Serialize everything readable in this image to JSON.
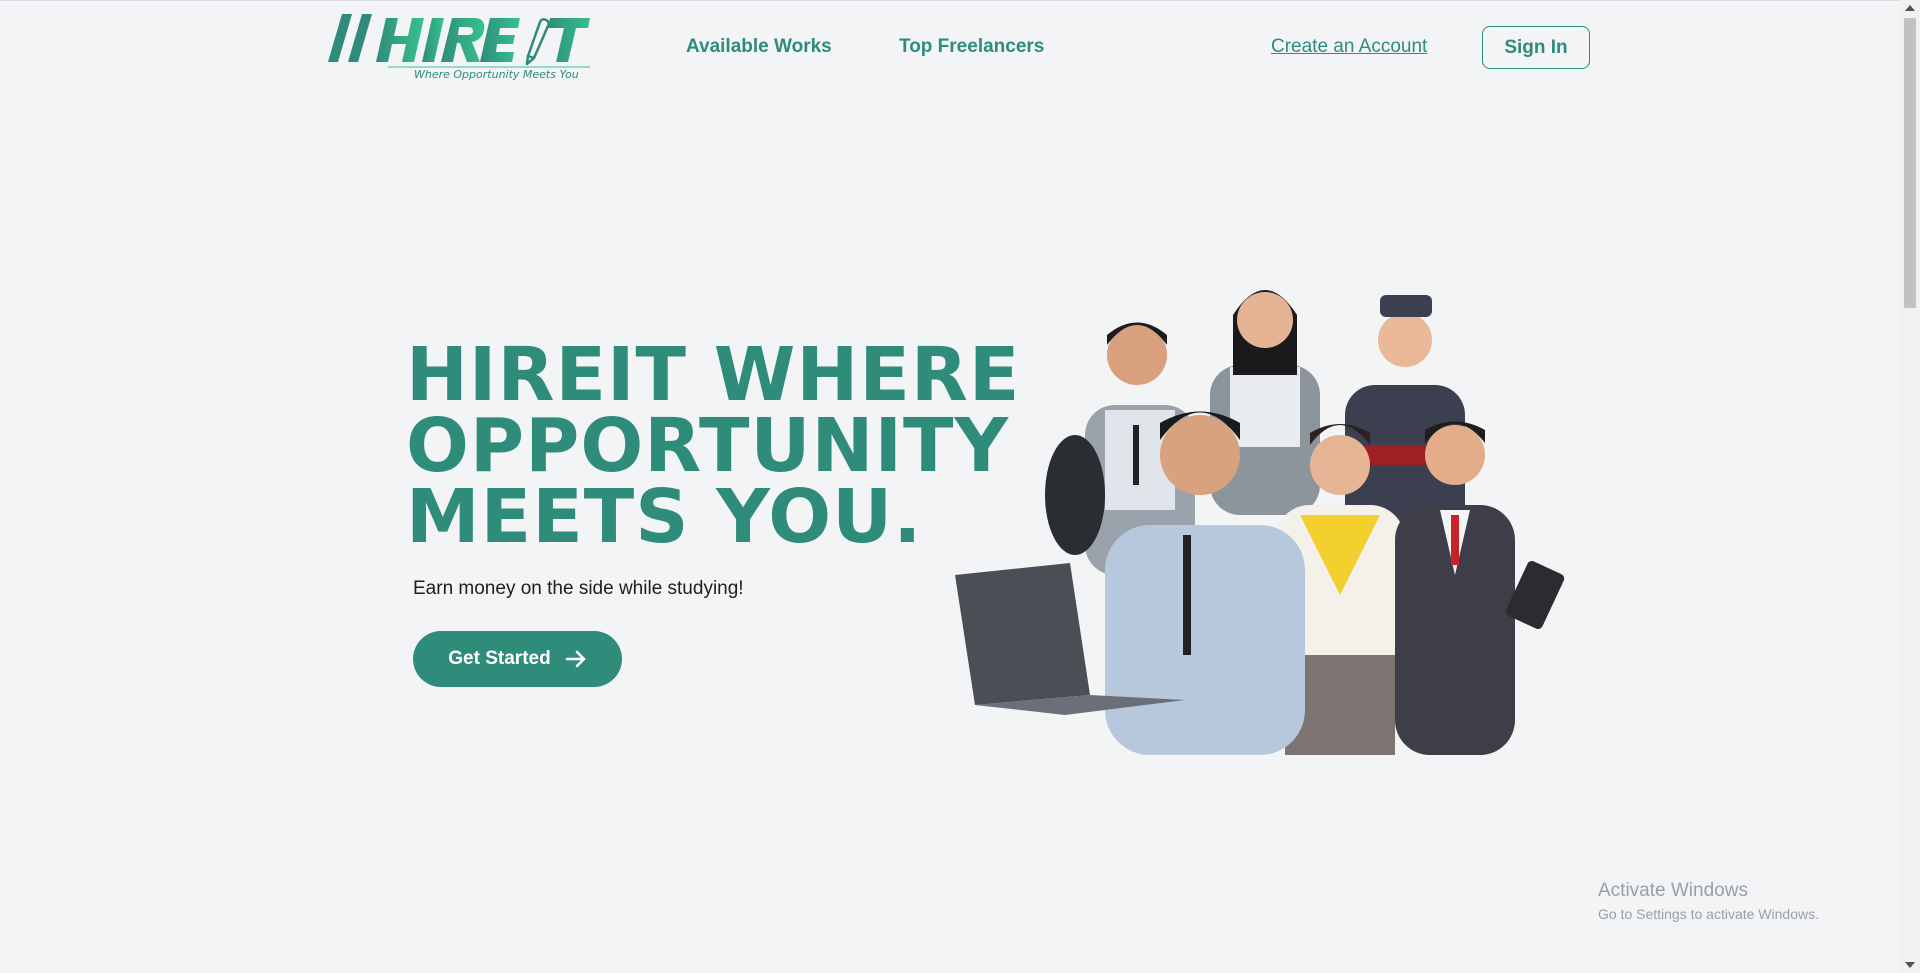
{
  "nav": {
    "logo_text": "HIREIT",
    "logo_tagline": "Where Opportunity Meets You",
    "available_works": "Available Works",
    "top_freelancers": "Top Freelancers",
    "create_account": "Create an Account",
    "sign_in": "Sign In"
  },
  "hero": {
    "title_line1": "HIREIT WHERE",
    "title_line2": "OPPORTUNITY",
    "title_line3": "MEETS YOU.",
    "subtitle": "Earn money on the side while studying!",
    "cta_label": "Get Started",
    "cta_icon": "arrow-right-icon"
  },
  "watermark": {
    "title": "Activate Windows",
    "subtitle": "Go to Settings to activate Windows."
  },
  "colors": {
    "brand": "#2f8c7a",
    "brand_light": "#35c28f",
    "background": "#f2f4f6"
  }
}
